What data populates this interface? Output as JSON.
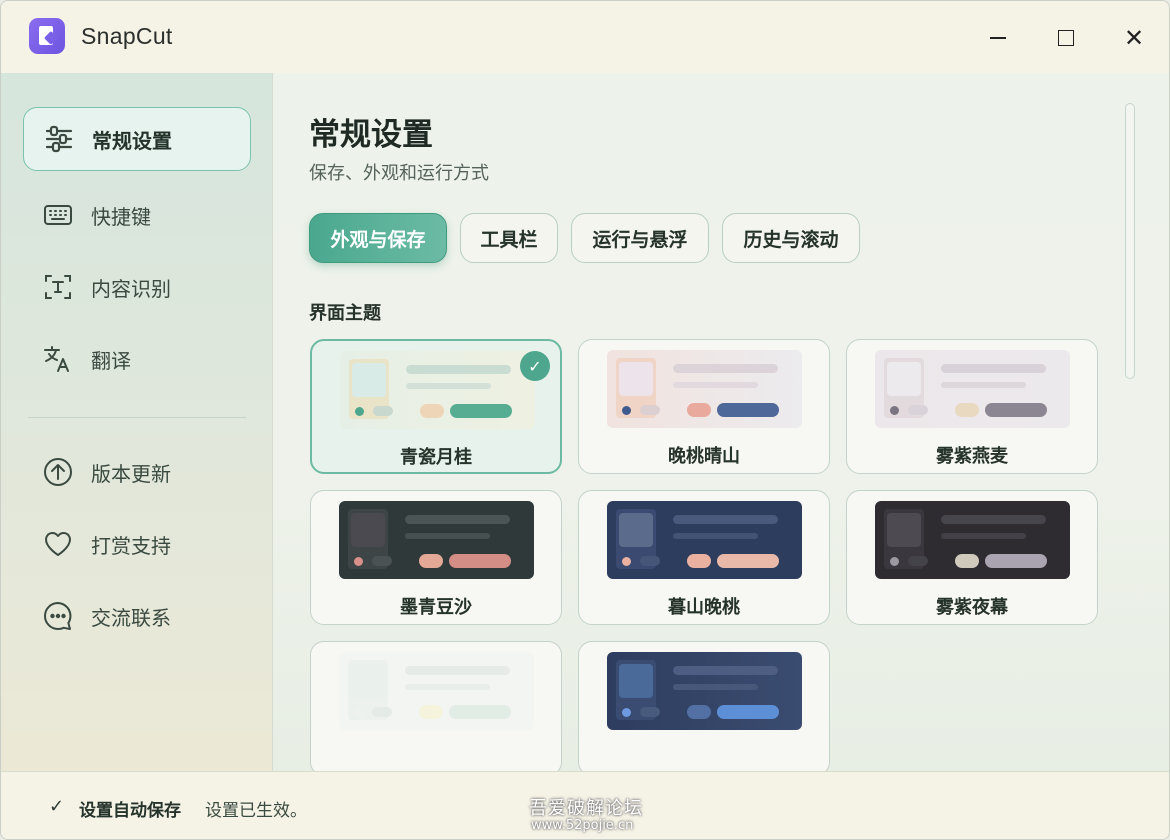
{
  "app": {
    "title": "SnapCut"
  },
  "window_controls": {
    "close": "✕"
  },
  "sidebar": {
    "items": [
      {
        "label": "常规设置",
        "icon": "sliders-icon",
        "active": true
      },
      {
        "label": "快捷键",
        "icon": "keyboard-icon",
        "active": false
      },
      {
        "label": "内容识别",
        "icon": "text-scan-icon",
        "active": false
      },
      {
        "label": "翻译",
        "icon": "translate-icon",
        "active": false
      },
      {
        "label": "版本更新",
        "icon": "arrow-up-circle-icon",
        "active": false
      },
      {
        "label": "打赏支持",
        "icon": "heart-icon",
        "active": false
      },
      {
        "label": "交流联系",
        "icon": "chat-bubble-icon",
        "active": false
      }
    ]
  },
  "main": {
    "title": "常规设置",
    "subtitle": "保存、外观和运行方式",
    "tabs": [
      {
        "label": "外观与保存",
        "active": true
      },
      {
        "label": "工具栏",
        "active": false
      },
      {
        "label": "运行与悬浮",
        "active": false
      },
      {
        "label": "历史与滚动",
        "active": false
      }
    ],
    "section_label": "界面主题",
    "themes": [
      {
        "name": "青瓷月桂",
        "selected": true
      },
      {
        "name": "晚桃晴山",
        "selected": false
      },
      {
        "name": "雾紫燕麦",
        "selected": false
      },
      {
        "name": "墨青豆沙",
        "selected": false
      },
      {
        "name": "暮山晚桃",
        "selected": false
      },
      {
        "name": "雾紫夜幕",
        "selected": false
      },
      {
        "name": "",
        "selected": false
      },
      {
        "name": "",
        "selected": false
      }
    ],
    "check_mark": "✓"
  },
  "status": {
    "check": "✓",
    "title": "设置自动保存",
    "message": "设置已生效。"
  },
  "watermark": {
    "line1": "吾爱破解论坛",
    "line2": "www.52pojie.cn"
  },
  "colors": {
    "accent": "#4da68d",
    "accent_border": "#7cc3ae"
  }
}
